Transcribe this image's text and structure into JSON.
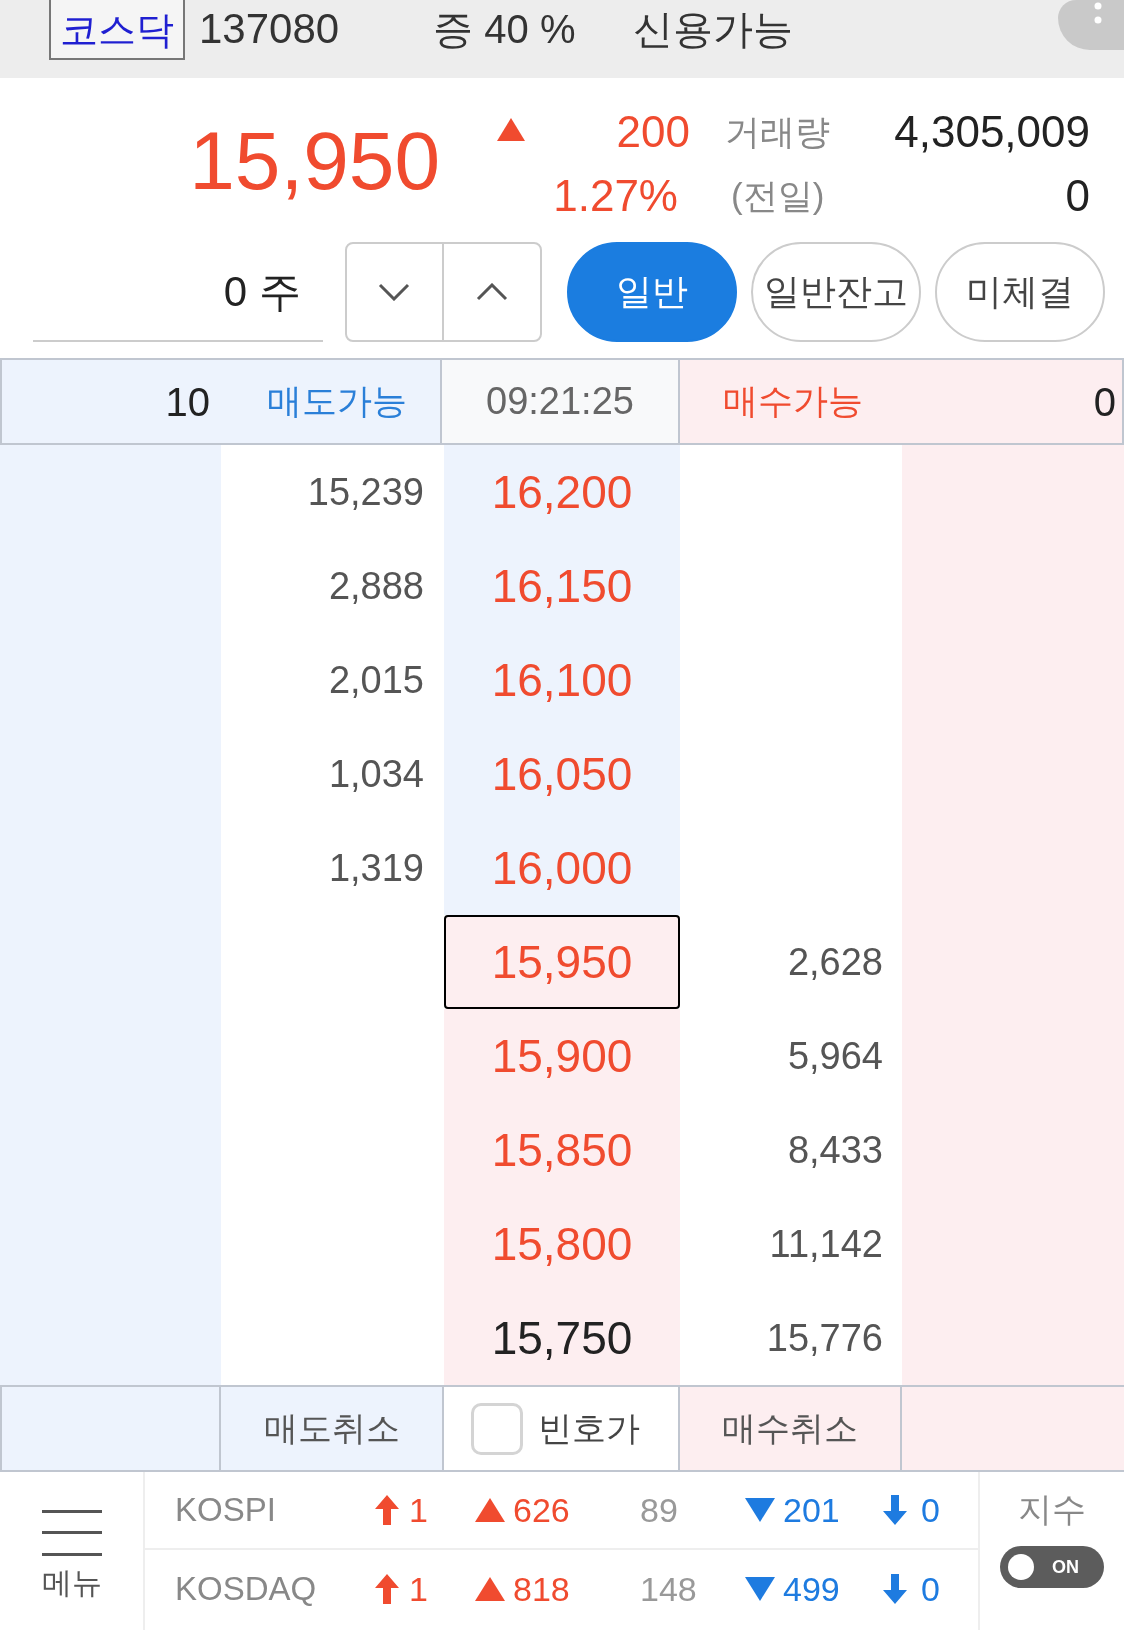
{
  "header": {
    "market": "코스닥",
    "code": "137080",
    "margin": "증 40 %",
    "credit": "신용가능"
  },
  "quote": {
    "price": "15,950",
    "rising": true,
    "change": "200",
    "change_rate": "1.27%",
    "volume_label": "거래량",
    "volume": "4,305,009",
    "prev_label": "(전일)",
    "prev_volume": "0"
  },
  "order": {
    "quantity": "0",
    "unit": "주",
    "tabs": [
      {
        "label": "일반",
        "selected": true
      },
      {
        "label": "일반잔고",
        "selected": false
      },
      {
        "label": "미체결",
        "selected": false
      }
    ]
  },
  "book": {
    "sell_available": "10",
    "sell_label": "매도가능",
    "time": "09:21:25",
    "buy_label": "매수가능",
    "buy_available": "0",
    "rows": [
      {
        "kind": "ask",
        "quantity": "15,239",
        "price": "16,200",
        "color": "#f04b2f",
        "current": false
      },
      {
        "kind": "ask",
        "quantity": "2,888",
        "price": "16,150",
        "color": "#f04b2f",
        "current": false
      },
      {
        "kind": "ask",
        "quantity": "2,015",
        "price": "16,100",
        "color": "#f04b2f",
        "current": false
      },
      {
        "kind": "ask",
        "quantity": "1,034",
        "price": "16,050",
        "color": "#f04b2f",
        "current": false
      },
      {
        "kind": "ask",
        "quantity": "1,319",
        "price": "16,000",
        "color": "#f04b2f",
        "current": false
      },
      {
        "kind": "bid",
        "quantity": "2,628",
        "price": "15,950",
        "color": "#f04b2f",
        "current": true
      },
      {
        "kind": "bid",
        "quantity": "5,964",
        "price": "15,900",
        "color": "#f04b2f",
        "current": false
      },
      {
        "kind": "bid",
        "quantity": "8,433",
        "price": "15,850",
        "color": "#f04b2f",
        "current": false
      },
      {
        "kind": "bid",
        "quantity": "11,142",
        "price": "15,800",
        "color": "#f04b2f",
        "current": false
      },
      {
        "kind": "bid",
        "quantity": "15,776",
        "price": "15,750",
        "color": "#222222",
        "current": false
      }
    ],
    "footer": {
      "sell_cancel": "매도취소",
      "empty_quote": {
        "label": "빈호가",
        "checked": false
      },
      "buy_cancel": "매수취소"
    }
  },
  "indices": {
    "menu_label": "메뉴",
    "rows": [
      {
        "name": "KOSPI",
        "limit_up": "1",
        "advancing": "626",
        "unchanged": "89",
        "declining": "201",
        "limit_down": "0"
      },
      {
        "name": "KOSDAQ",
        "limit_up": "1",
        "advancing": "818",
        "unchanged": "148",
        "declining": "499",
        "limit_down": "0"
      }
    ],
    "index_label": "지수",
    "toggle": {
      "label": "ON",
      "on": true
    }
  }
}
